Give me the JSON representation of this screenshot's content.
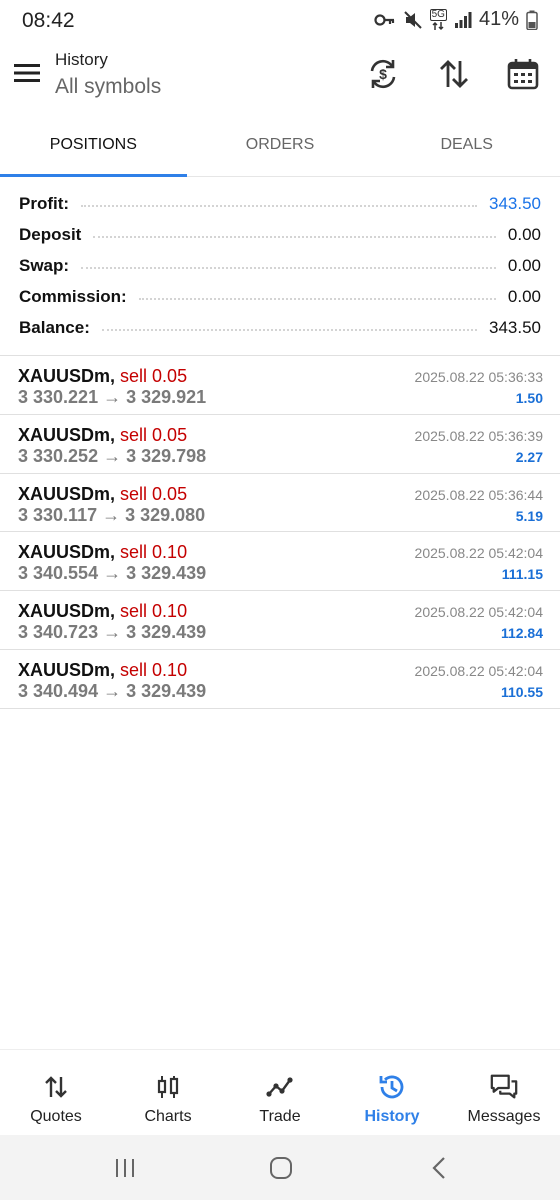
{
  "status": {
    "time": "08:42",
    "network": "5G",
    "battery": "41%"
  },
  "header": {
    "title": "History",
    "subtitle": "All symbols",
    "icons": [
      "menu-icon",
      "currency-exchange-icon",
      "sort-icon",
      "calendar-icon"
    ]
  },
  "tabs": [
    {
      "label": "POSITIONS",
      "active": true
    },
    {
      "label": "ORDERS",
      "active": false
    },
    {
      "label": "DEALS",
      "active": false
    }
  ],
  "summary": {
    "profit": {
      "label": "Profit:",
      "value": "343.50"
    },
    "deposit": {
      "label": "Deposit",
      "value": "0.00"
    },
    "swap": {
      "label": "Swap:",
      "value": "0.00"
    },
    "commission": {
      "label": "Commission:",
      "value": "0.00"
    },
    "balance": {
      "label": "Balance:",
      "value": "343.50"
    }
  },
  "positions": [
    {
      "symbol": "XAUUSDm,",
      "side": "sell 0.05",
      "prices": "3 330.221 → 3 329.921",
      "time": "2025.08.22 05:36:33",
      "profit": "1.50"
    },
    {
      "symbol": "XAUUSDm,",
      "side": "sell 0.05",
      "prices": "3 330.252 → 3 329.798",
      "time": "2025.08.22 05:36:39",
      "profit": "2.27"
    },
    {
      "symbol": "XAUUSDm,",
      "side": "sell 0.05",
      "prices": "3 330.117 → 3 329.080",
      "time": "2025.08.22 05:36:44",
      "profit": "5.19"
    },
    {
      "symbol": "XAUUSDm,",
      "side": "sell 0.10",
      "prices": "3 340.554 → 3 329.439",
      "time": "2025.08.22 05:42:04",
      "profit": "111.15"
    },
    {
      "symbol": "XAUUSDm,",
      "side": "sell 0.10",
      "prices": "3 340.723 → 3 329.439",
      "time": "2025.08.22 05:42:04",
      "profit": "112.84"
    },
    {
      "symbol": "XAUUSDm,",
      "side": "sell 0.10",
      "prices": "3 340.494 → 3 329.439",
      "time": "2025.08.22 05:42:04",
      "profit": "110.55"
    }
  ],
  "bottom_nav": [
    {
      "label": "Quotes",
      "icon": "quotes-icon",
      "active": false
    },
    {
      "label": "Charts",
      "icon": "charts-icon",
      "active": false
    },
    {
      "label": "Trade",
      "icon": "trade-icon",
      "active": false
    },
    {
      "label": "History",
      "icon": "history-icon",
      "active": true
    },
    {
      "label": "Messages",
      "icon": "messages-icon",
      "active": false
    }
  ],
  "colors": {
    "accent": "#2f80e8",
    "sell": "#c40000",
    "profit": "#1a6fd6"
  }
}
